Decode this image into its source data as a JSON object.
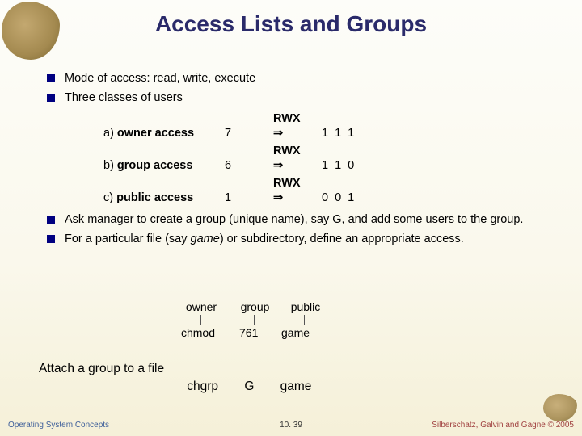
{
  "title": "Access Lists and Groups",
  "bullets": {
    "b1": "Mode of access:  read, write, execute",
    "b2": "Three classes of users",
    "b3": "Ask manager to create a group (unique name), say G, and add some users to the group.",
    "b4_pre": "For a particular file (say ",
    "b4_it": "game",
    "b4_post": ") or subdirectory, define an appropriate access."
  },
  "perm": {
    "rwx": "RWX",
    "arrow": "⇒",
    "rows": {
      "a": {
        "label_pre": "a) ",
        "label_b": "owner access",
        "num": "7",
        "bits": "1 1 1"
      },
      "b": {
        "label_pre": "b) ",
        "label_b": "group access",
        "num": "6",
        "bits": "1 1 0"
      },
      "c": {
        "label_pre": "c) ",
        "label_b": "public access",
        "num": "1",
        "bits": "0 0 1"
      }
    }
  },
  "cmd": {
    "labels": {
      "owner": "owner",
      "group": "group",
      "public": "public"
    },
    "chmod": {
      "cmd": "chmod",
      "num": "761",
      "file": "game"
    }
  },
  "attach": {
    "text": "Attach a group to a file",
    "chgrp": "chgrp",
    "grp": "G",
    "file": "game"
  },
  "footer": {
    "left": "Operating System Concepts",
    "center": "10. 39",
    "right": "Silberschatz, Galvin and Gagne © 2005"
  }
}
